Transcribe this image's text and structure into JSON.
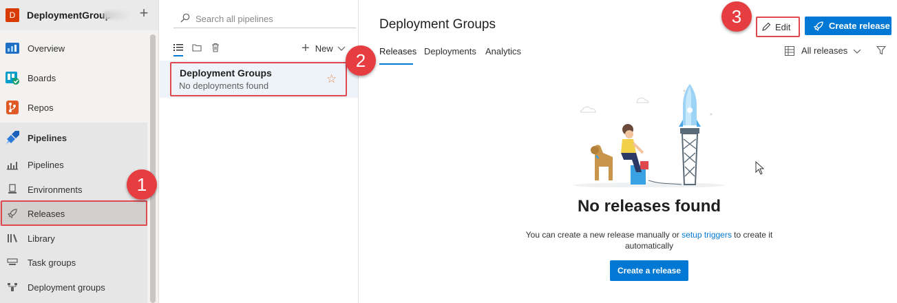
{
  "project": {
    "initial": "D",
    "name": "DeploymentGroup"
  },
  "nav": {
    "items": [
      {
        "label": "Overview",
        "icon": "overview-icon"
      },
      {
        "label": "Boards",
        "icon": "boards-icon"
      },
      {
        "label": "Repos",
        "icon": "repos-icon"
      },
      {
        "label": "Pipelines",
        "icon": "pipelines-icon"
      }
    ],
    "sub_items": [
      {
        "label": "Pipelines",
        "icon": "pipelines-bar-icon"
      },
      {
        "label": "Environments",
        "icon": "environments-icon"
      },
      {
        "label": "Releases",
        "icon": "rocket-icon"
      },
      {
        "label": "Library",
        "icon": "library-icon"
      },
      {
        "label": "Task groups",
        "icon": "task-groups-icon"
      },
      {
        "label": "Deployment groups",
        "icon": "deployment-groups-icon"
      }
    ]
  },
  "pipelines_pane": {
    "search_placeholder": "Search all pipelines",
    "new_label": "New",
    "items": [
      {
        "title": "Deployment Groups",
        "subtitle": "No deployments found"
      }
    ]
  },
  "main": {
    "title": "Deployment Groups",
    "edit_label": "Edit",
    "create_release_label": "Create release",
    "tabs": [
      "Releases",
      "Deployments",
      "Analytics"
    ],
    "filter_label": "All releases",
    "empty_title": "No releases found",
    "empty_text_before": "You can create a new release manually or ",
    "empty_link": "setup triggers",
    "empty_text_after": " to create it automatically",
    "cta_label": "Create a release"
  },
  "callouts": [
    "1",
    "2",
    "3"
  ],
  "colors": {
    "accent": "#0078d4",
    "highlight": "#e0474e",
    "project": "#d83b01"
  }
}
